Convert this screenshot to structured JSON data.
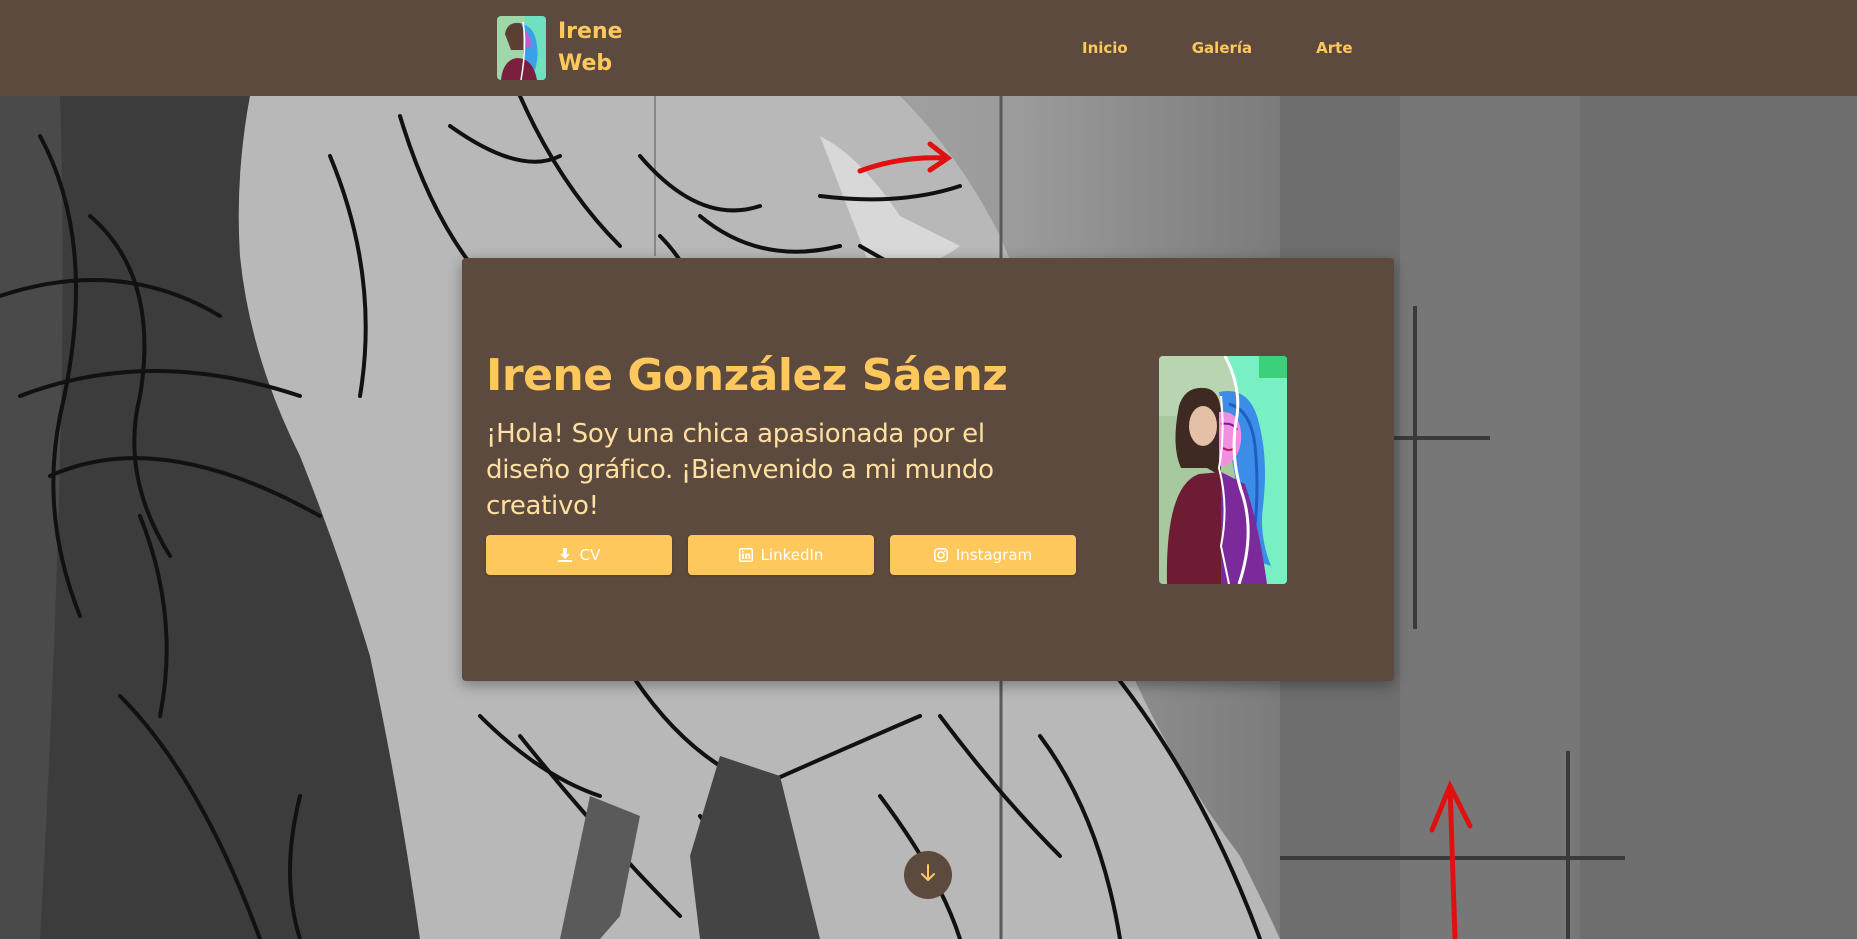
{
  "navbar": {
    "brand_text": "Irene Web",
    "brand_logo": "portrait-logo",
    "links": [
      {
        "label": "Inicio"
      },
      {
        "label": "Galería"
      },
      {
        "label": "Arte"
      }
    ]
  },
  "hero": {
    "name": "Irene González Sáenz",
    "intro": "¡Hola! Soy una chica apasionada por el diseño gráfico. ¡Bienvenido a mi mundo creativo!",
    "buttons": [
      {
        "label": "CV",
        "icon": "download-icon"
      },
      {
        "label": "LinkedIn",
        "icon": "linkedin-icon"
      },
      {
        "label": "Instagram",
        "icon": "instagram-icon"
      }
    ],
    "portrait": "split-portrait-photo-illustration",
    "scroll_icon": "arrow-down-icon"
  },
  "colors": {
    "brown": "#5d4a3f",
    "accent": "#ffc85c",
    "intro_text": "#ffe0a0",
    "button_text": "#ffffff"
  }
}
